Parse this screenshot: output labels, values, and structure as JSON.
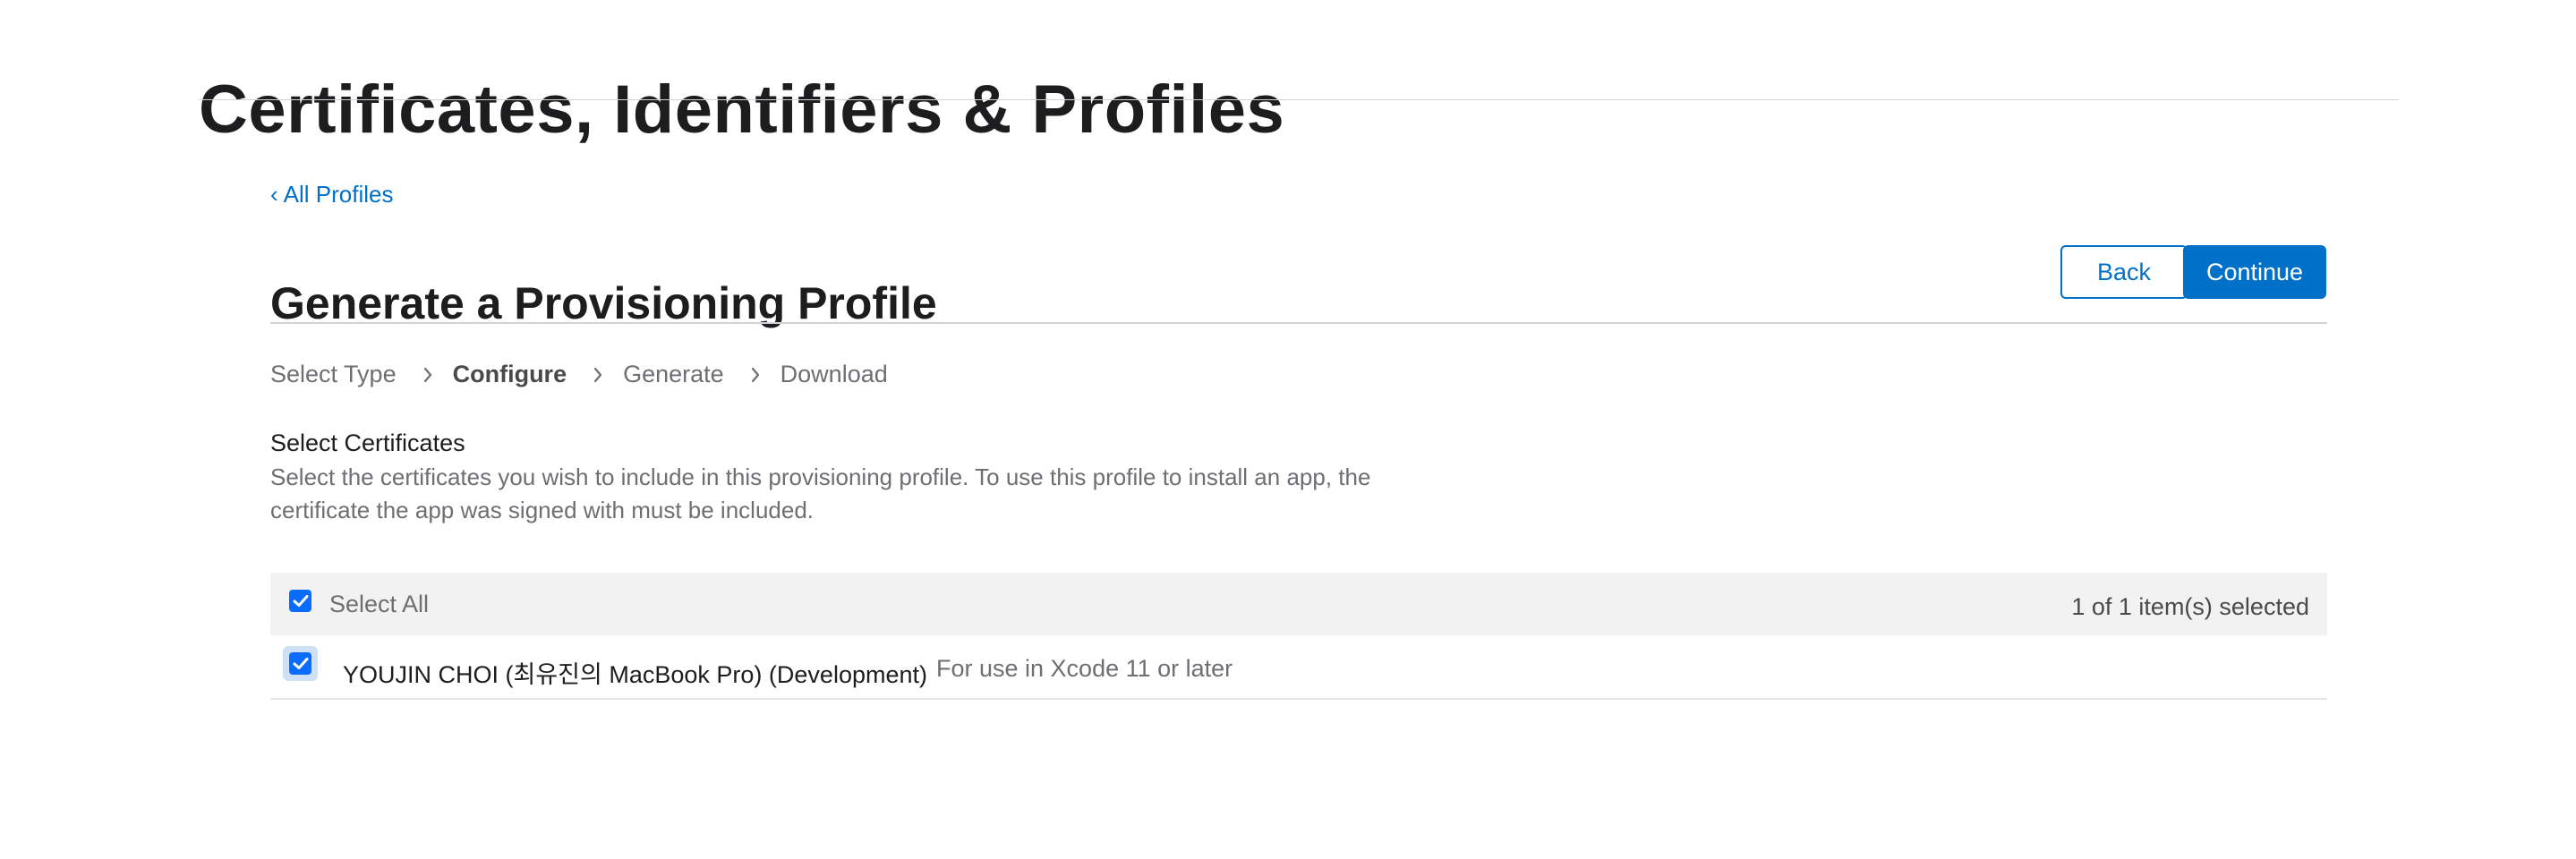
{
  "header": {
    "title": "Certificates, Identifiers & Profiles"
  },
  "nav": {
    "back_link": "All Profiles"
  },
  "main": {
    "title": "Generate a Provisioning Profile",
    "buttons": {
      "back": "Back",
      "continue": "Continue"
    },
    "steps": [
      {
        "label": "Select Type",
        "current": false
      },
      {
        "label": "Configure",
        "current": true
      },
      {
        "label": "Generate",
        "current": false
      },
      {
        "label": "Download",
        "current": false
      }
    ],
    "certificates": {
      "heading": "Select Certificates",
      "description": "Select the certificates you wish to include in this provisioning profile. To use this profile to install an app, the certificate the app was signed with must be included.",
      "select_all_label": "Select All",
      "select_all_checked": true,
      "selected_count": "1 of 1 item(s) selected",
      "items": [
        {
          "name": "YOUJIN CHOI (최유진의 MacBook Pro) (Development)",
          "note": "For use in Xcode 11 or later",
          "checked": true
        }
      ]
    }
  },
  "colors": {
    "accent": "#0070c9",
    "checkbox": "#0a6cff",
    "text_primary": "#1d1d1f",
    "text_secondary": "#6e6e73",
    "header_row_bg": "#f2f2f2"
  },
  "icons": {
    "back_link": "chevron-left-icon",
    "step_separator": "chevron-right-icon",
    "checkbox": "checkmark-icon"
  }
}
